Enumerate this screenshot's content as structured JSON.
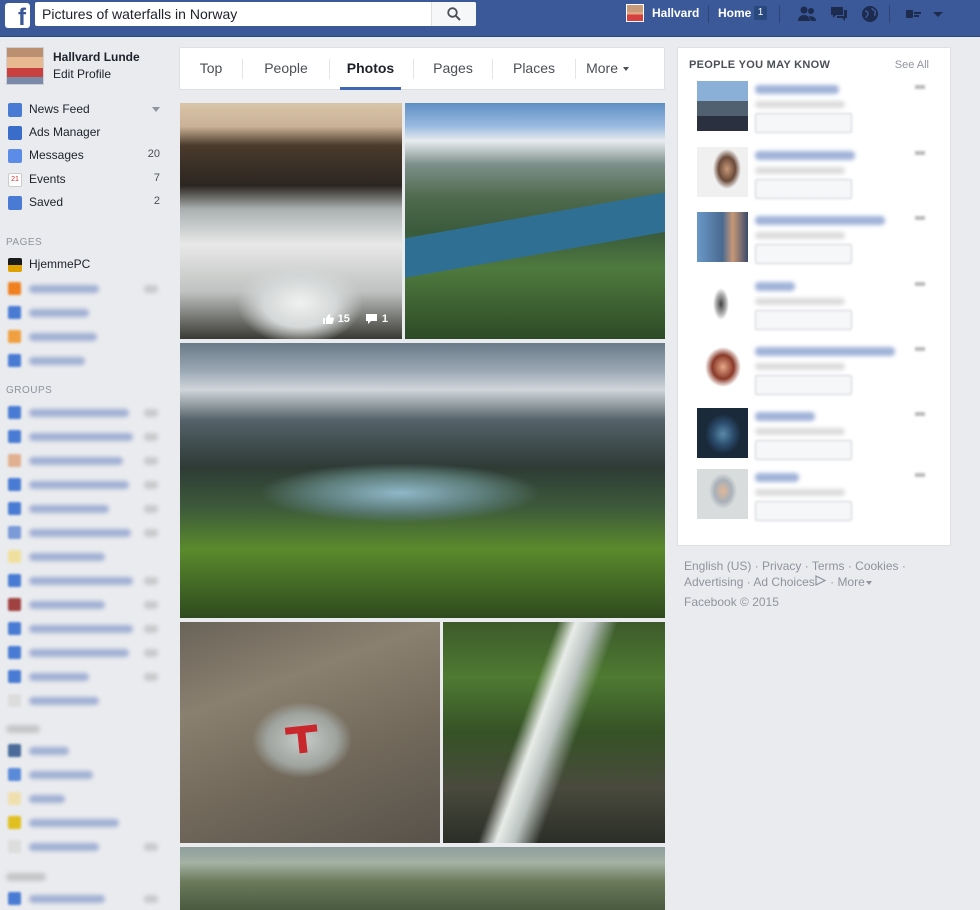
{
  "search": {
    "value": "Pictures of waterfalls in Norway"
  },
  "topbar": {
    "user_name": "Hallvard",
    "home_label": "Home",
    "home_badge": "1"
  },
  "profile": {
    "name": "Hallvard Lunde",
    "edit_label": "Edit Profile"
  },
  "favorites": [
    {
      "label": "News Feed",
      "count": ""
    },
    {
      "label": "Ads Manager",
      "count": ""
    },
    {
      "label": "Messages",
      "count": "20"
    },
    {
      "label": "Events",
      "count": "7"
    },
    {
      "label": "Saved",
      "count": "2"
    }
  ],
  "sections": {
    "pages": "PAGES",
    "groups": "GROUPS"
  },
  "pages_list": [
    {
      "label": "HjemmePC"
    }
  ],
  "tabs": [
    {
      "label": "Top"
    },
    {
      "label": "People"
    },
    {
      "label": "Photos"
    },
    {
      "label": "Pages"
    },
    {
      "label": "Places"
    },
    {
      "label": "More"
    }
  ],
  "active_tab": "Photos",
  "photos": [
    {
      "likes": "15",
      "comments": "1"
    }
  ],
  "pymk": {
    "title": "PEOPLE YOU MAY KNOW",
    "see_all": "See All"
  },
  "footer": {
    "english": "English (US)",
    "privacy": "Privacy",
    "terms": "Terms",
    "cookies": "Cookies",
    "advertising": "Advertising",
    "ad_choices": "Ad Choices",
    "more": "More",
    "copyright": "Facebook © 2015"
  },
  "colors": {
    "topbar": "#3b5998",
    "accent": "#4267b2",
    "background": "#e9ebee"
  }
}
